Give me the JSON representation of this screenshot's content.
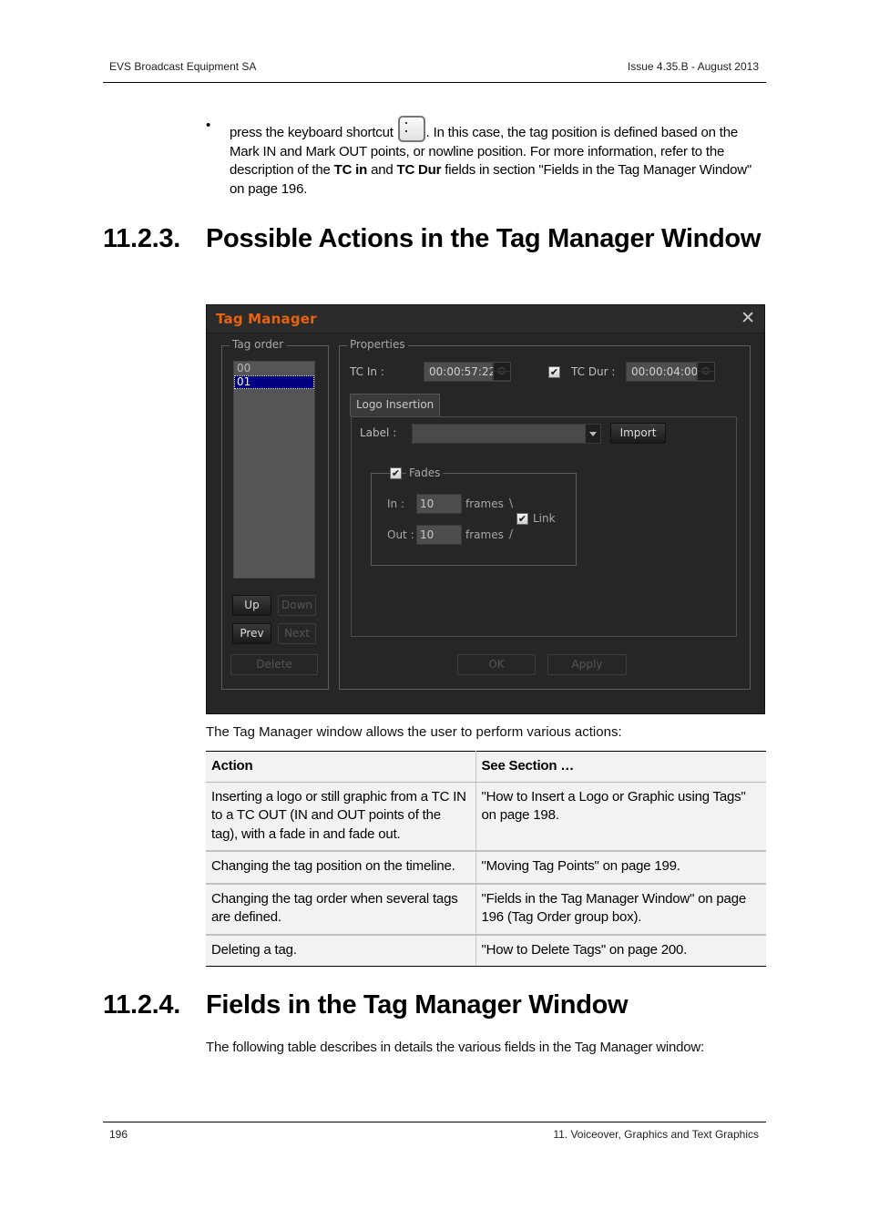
{
  "header": {
    "company": "EVS Broadcast Equipment SA",
    "issue": "Issue 4.35.B - August 2013"
  },
  "intro_bullet": {
    "bullet": "•",
    "text_before_key": "press the keyboard shortcut",
    "key_icon": "colon-key-icon",
    "text_after_key_1": ". In this case, the tag position is defined based on the Mark IN and Mark OUT points, or nowline position. For more information, refer to the description of the ",
    "bold_1": "TC in",
    "text_mid": " and ",
    "bold_2": "TC Dur",
    "text_end": " fields in section \"Fields in the Tag Manager Window\" on page 196."
  },
  "section_1": {
    "number": "11.2.3.",
    "title": "Possible Actions in the Tag Manager Window"
  },
  "tag_manager": {
    "title": "Tag Manager",
    "close_icon": "close-icon",
    "tag_order": {
      "label": "Tag order",
      "items": [
        "00",
        "01"
      ],
      "selected": "01",
      "buttons": {
        "up": "Up",
        "down": "Down",
        "prev": "Prev",
        "next": "Next",
        "delete": "Delete"
      }
    },
    "properties": {
      "label": "Properties",
      "tc_in_label": "TC In :",
      "tc_in_value": "00:00:57:22",
      "tc_dur_checked": true,
      "tc_dur_label": "TC Dur :",
      "tc_dur_value": "00:00:04:00",
      "tab": "Logo Insertion",
      "label_field_label": "Label :",
      "label_field_value": "",
      "import_button": "Import",
      "fades": {
        "label": "Fades",
        "checked": true,
        "in_label": "In :",
        "in_value": "10",
        "in_unit": "frames",
        "in_bracket": "\\",
        "out_label": "Out :",
        "out_value": "10",
        "out_unit": "frames",
        "out_bracket": "/",
        "link_label": "Link",
        "link_checked": true
      },
      "ok_button": "OK",
      "apply_button": "Apply"
    },
    "check_mark": "✔"
  },
  "caption": "The Tag Manager window allows the user to perform various actions:",
  "actions_table": {
    "headers": [
      "Action",
      "See Section …"
    ],
    "rows": [
      [
        "Inserting a logo or still graphic from a TC IN to a TC OUT (IN and OUT points of the tag), with a fade in and fade out.",
        "\"How to Insert a Logo or Graphic using Tags\" on page 198."
      ],
      [
        "Changing the tag position on the timeline.",
        "\"Moving Tag Points\" on page 199."
      ],
      [
        "Changing the tag order when several tags are defined.",
        "\"Fields in the Tag Manager Window\" on page 196 (Tag Order group box)."
      ],
      [
        "Deleting a tag.",
        "\"How to Delete Tags\" on page 200."
      ]
    ]
  },
  "section_2": {
    "number": "11.2.4.",
    "title": "Fields in the Tag Manager Window",
    "intro": "The following table describes in details the various fields in the Tag Manager window:"
  },
  "footer": {
    "page_number": "196",
    "chapter": "11. Voiceover, Graphics and Text Graphics"
  }
}
